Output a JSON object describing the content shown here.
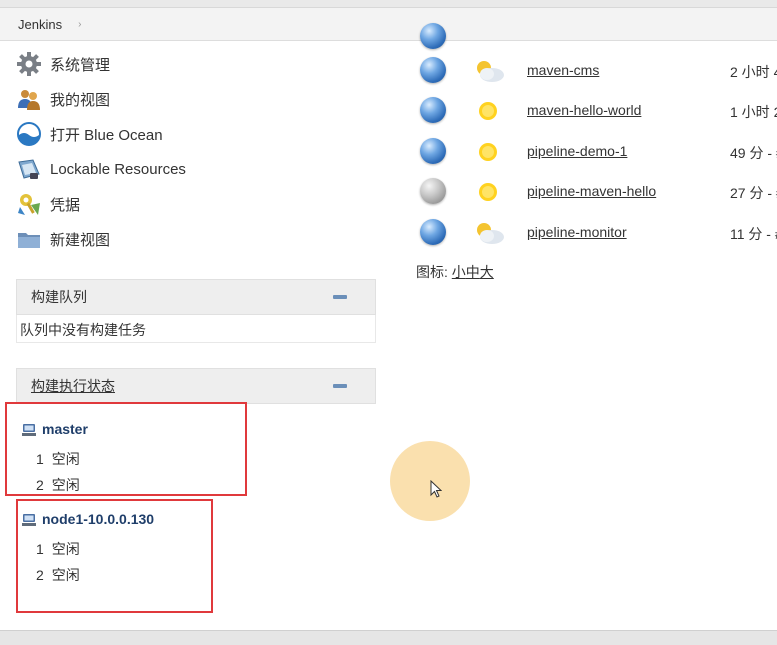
{
  "breadcrumb": {
    "root": "Jenkins",
    "separator": "›"
  },
  "tasks": [
    {
      "label": "系统管理",
      "icon": "gear-icon"
    },
    {
      "label": "我的视图",
      "icon": "user-group-icon"
    },
    {
      "label": "打开 Blue Ocean",
      "icon": "blue-ocean-icon"
    },
    {
      "label": "Lockable Resources",
      "icon": "lock-resources-icon"
    },
    {
      "label": "凭据",
      "icon": "credentials-icon"
    },
    {
      "label": "新建视图",
      "icon": "folder-icon"
    }
  ],
  "build_queue": {
    "title": "构建队列",
    "empty_text": "队列中没有构建任务"
  },
  "executors": {
    "title": "构建执行状态",
    "nodes": [
      {
        "name": "master",
        "executors": [
          {
            "num": "1",
            "status": "空闲"
          },
          {
            "num": "2",
            "status": "空闲"
          }
        ]
      },
      {
        "name": "node1-10.0.0.130",
        "executors": [
          {
            "num": "1",
            "status": "空闲"
          },
          {
            "num": "2",
            "status": "空闲"
          }
        ]
      }
    ]
  },
  "jobs": [
    {
      "name": "maven-cms",
      "status": "blue",
      "weather": "partly-cloudy",
      "last_time": "2 小时 4"
    },
    {
      "name": "maven-hello-world",
      "status": "blue",
      "weather": "sunny",
      "last_time": "1 小时 2"
    },
    {
      "name": "pipeline-demo-1",
      "status": "blue",
      "weather": "sunny",
      "last_time": "49 分 - #"
    },
    {
      "name": "pipeline-maven-hello",
      "status": "grey",
      "weather": "sunny",
      "last_time": "27 分 - #"
    },
    {
      "name": "pipeline-monitor",
      "status": "blue",
      "weather": "partly-cloudy",
      "last_time": "11 分 - #"
    }
  ],
  "icon_legend": {
    "label": "图标:",
    "small": "小",
    "medium": "中",
    "large": "大"
  },
  "colors": {
    "highlight_box": "#e0393c",
    "accent": "#6b8fb9",
    "cursor_halo": "#f8d38c"
  }
}
